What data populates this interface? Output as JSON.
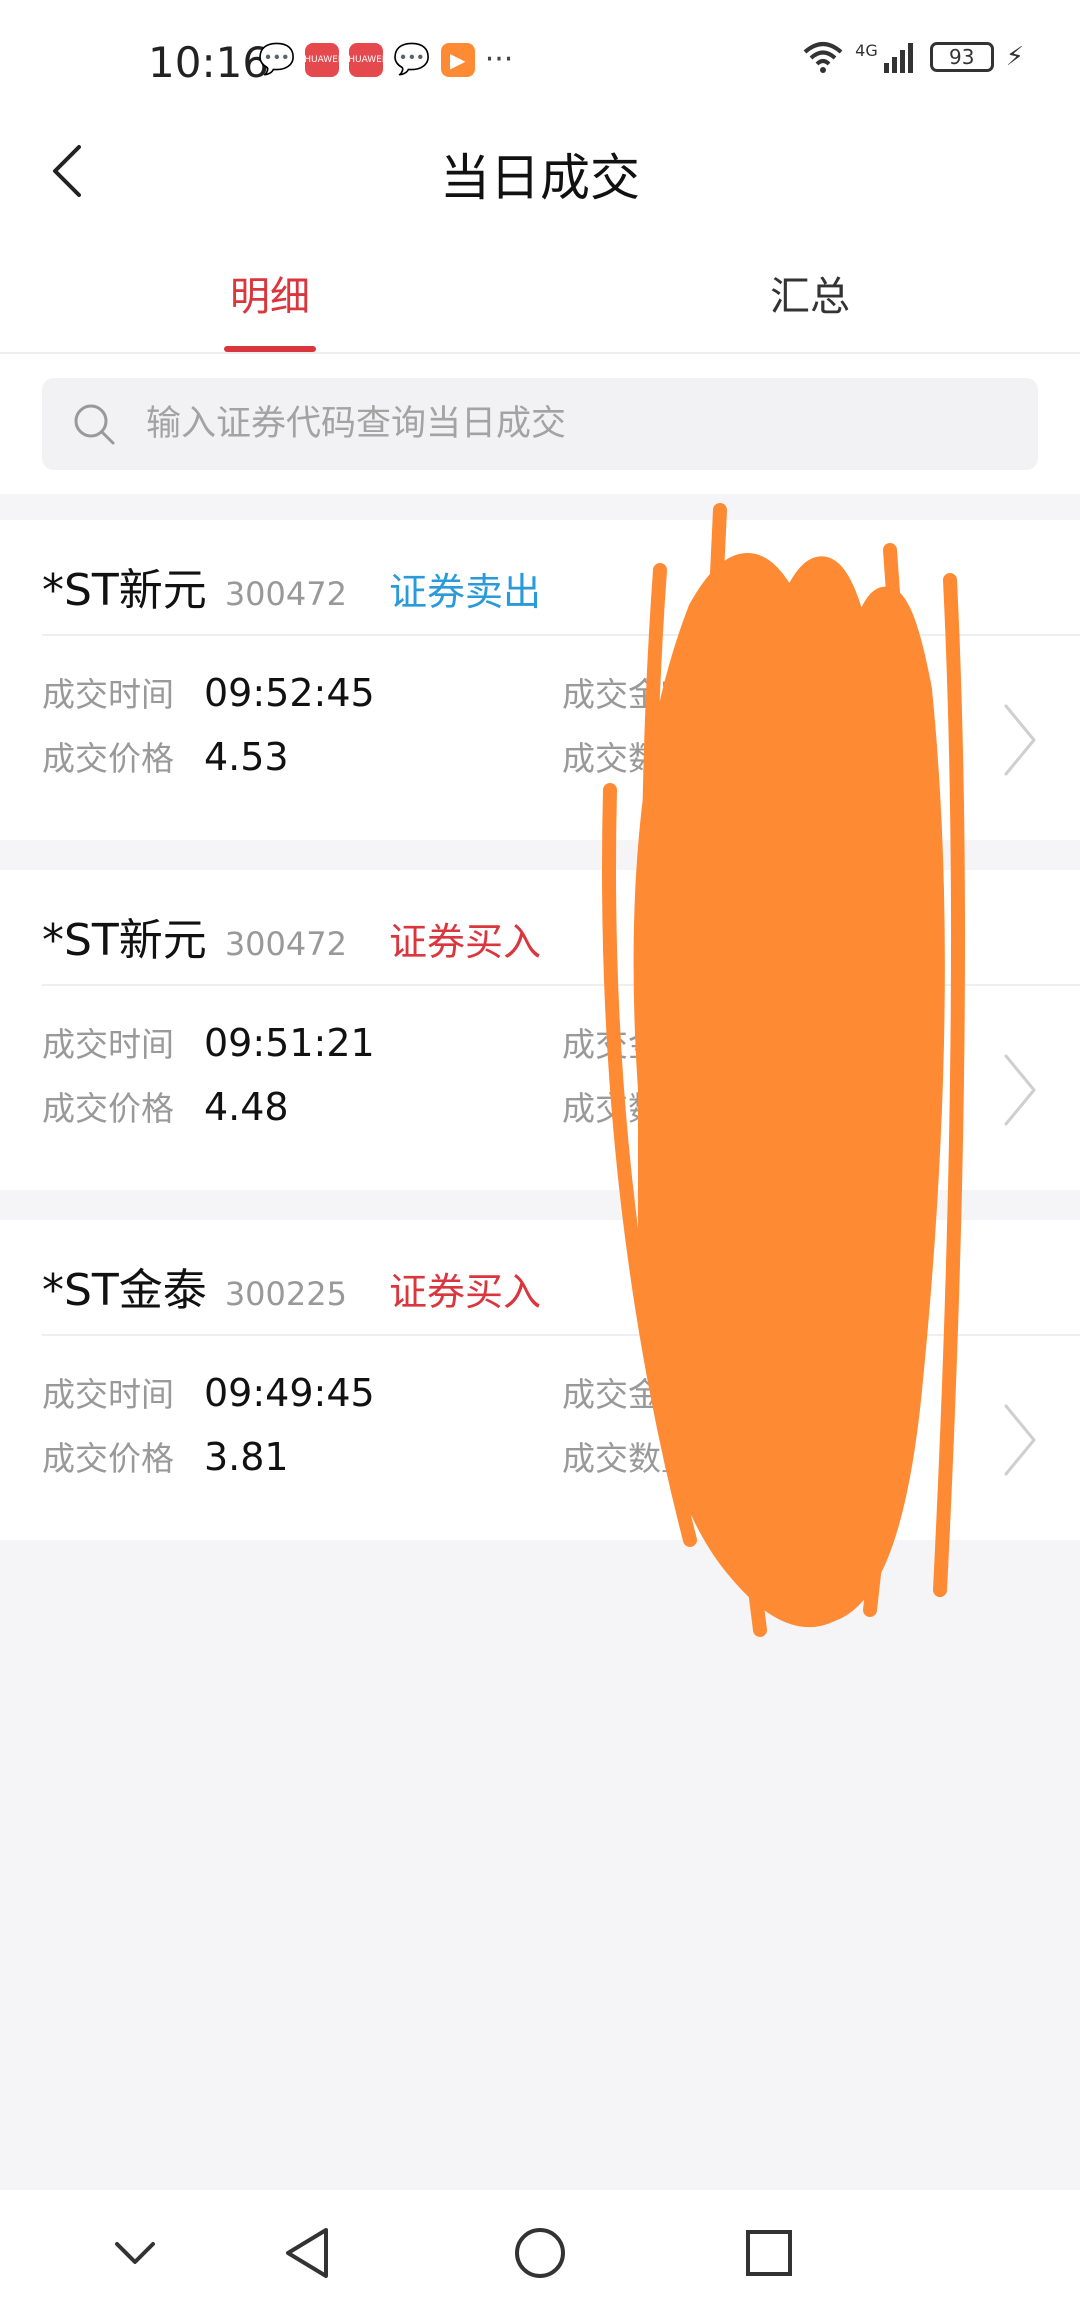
{
  "status_bar": {
    "time": "10:16",
    "app_badge_text": "HUAWEI",
    "overflow": "···",
    "network": "4G",
    "battery": "93"
  },
  "header": {
    "title": "当日成交"
  },
  "tabs": [
    {
      "label": "明细",
      "active": true
    },
    {
      "label": "汇总",
      "active": false
    }
  ],
  "search": {
    "placeholder": "输入证券代码查询当日成交",
    "value": ""
  },
  "field_labels": {
    "time": "成交时间",
    "price": "成交价格",
    "amount": "成交金额",
    "quantity": "成交数量"
  },
  "trades": [
    {
      "name": "*ST新元",
      "code": "300472",
      "type": "证券卖出",
      "side": "sell",
      "time": "09:52:45",
      "price": "4.53"
    },
    {
      "name": "*ST新元",
      "code": "300472",
      "type": "证券买入",
      "side": "buy",
      "time": "09:51:21",
      "price": "4.48"
    },
    {
      "name": "*ST金泰",
      "code": "300225",
      "type": "证券买入",
      "side": "buy",
      "time": "09:49:45",
      "price": "3.81"
    }
  ],
  "colors": {
    "accent_red": "#d9363e",
    "sell_blue": "#2a9bd8",
    "scribble_orange": "#ff8a34",
    "background": "#f5f4f7"
  },
  "icons": {
    "back": "chevron-left-icon",
    "search": "search-icon",
    "row_arrow": "chevron-right-icon",
    "nav_down": "chevron-down-icon",
    "nav_back": "triangle-back-icon",
    "nav_home": "circle-home-icon",
    "nav_recent": "square-recent-icon"
  }
}
